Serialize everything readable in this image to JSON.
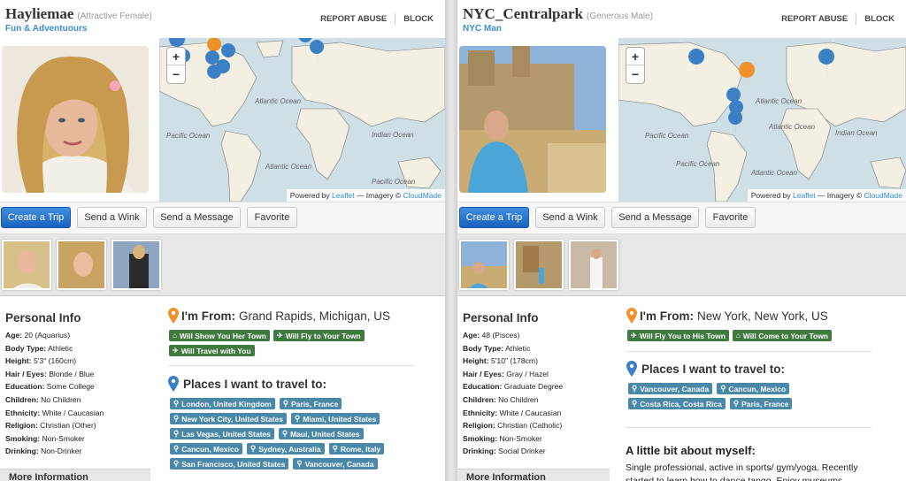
{
  "left": {
    "username": "Hayliemae",
    "user_type": "(Attractive Female)",
    "tagline": "Fun & Adventuours",
    "report_label": "REPORT ABUSE",
    "block_label": "BLOCK",
    "map": {
      "labels": [
        "Atlantic Ocean",
        "Pacific Ocean",
        "Indian Ocean",
        "Atlantic Ocean",
        "Pacific Ocean"
      ],
      "attribution_prefix": "Powered by",
      "attribution_leaflet": "Leaflet",
      "attribution_mid": "— Imagery ©",
      "attribution_cloudmade": "CloudMade",
      "zoom_in": "+",
      "zoom_out": "−"
    },
    "buttons": {
      "create_trip": "Create a Trip",
      "send_wink": "Send a Wink",
      "send_message": "Send a Message",
      "favorite": "Favorite"
    },
    "personal_info_title": "Personal Info",
    "info_rows": [
      {
        "label": "Age:",
        "value": "20 (Aquarius)"
      },
      {
        "label": "Body Type:",
        "value": "Athletic"
      },
      {
        "label": "Height:",
        "value": "5'3\" (160cm)"
      },
      {
        "label": "Hair / Eyes:",
        "value": "Blonde / Blue"
      },
      {
        "label": "Education:",
        "value": "Some College"
      },
      {
        "label": "Children:",
        "value": "No Children"
      },
      {
        "label": "Ethnicity:",
        "value": "White / Caucasian"
      },
      {
        "label": "Religion:",
        "value": "Christian (Other)"
      },
      {
        "label": "Smoking:",
        "value": "Non-Smoker"
      },
      {
        "label": "Drinking:",
        "value": "Non-Drinker"
      }
    ],
    "info_footer": "More Information",
    "from_label": "I'm From:",
    "from_value": "Grand Rapids, Michigan, US",
    "green_badges": [
      "Will Show You Her Town",
      "Will Fly to Your Town",
      "Will Travel with You"
    ],
    "places_title": "Places I want to travel to:",
    "places": [
      "London, United Kingdom",
      "Paris, France",
      "New York City, United States",
      "Miami, United States",
      "Las Vegas, United States",
      "Maui, United States",
      "Cancun, Mexico",
      "Sydney, Australia",
      "Rome, Italy",
      "San Francisco, United States",
      "Vancouver, Canada"
    ]
  },
  "right": {
    "username": "NYC_Centralpark",
    "user_type": "(Generous Male)",
    "tagline": "NYC Man",
    "report_label": "REPORT ABUSE",
    "block_label": "BLOCK",
    "map": {
      "labels": [
        "Atlantic Ocean",
        "Pacific Ocean",
        "Atlantic Ocean",
        "Indian Ocean",
        "Pacific Ocean",
        "Atlantic Ocean"
      ],
      "attribution_prefix": "Powered by",
      "attribution_leaflet": "Leaflet",
      "attribution_mid": "— Imagery ©",
      "attribution_cloudmade": "CloudMade",
      "zoom_in": "+",
      "zoom_out": "−"
    },
    "buttons": {
      "create_trip": "Create a Trip",
      "send_wink": "Send a Wink",
      "send_message": "Send a Message",
      "favorite": "Favorite"
    },
    "personal_info_title": "Personal Info",
    "info_rows": [
      {
        "label": "Age:",
        "value": "48 (Pisces)"
      },
      {
        "label": "Body Type:",
        "value": "Athletic"
      },
      {
        "label": "Height:",
        "value": "5'10\" (178cm)"
      },
      {
        "label": "Hair / Eyes:",
        "value": "Gray / Hazel"
      },
      {
        "label": "Education:",
        "value": "Graduate Degree"
      },
      {
        "label": "Children:",
        "value": "No Children"
      },
      {
        "label": "Ethnicity:",
        "value": "White / Caucasian"
      },
      {
        "label": "Religion:",
        "value": "Christian (Catholic)"
      },
      {
        "label": "Smoking:",
        "value": "Non-Smoker"
      },
      {
        "label": "Drinking:",
        "value": "Social Drinker"
      }
    ],
    "info_footer": "More Information",
    "from_label": "I'm From:",
    "from_value": "New York, New York, US",
    "green_badges": [
      "Will Fly You to His Town",
      "Will Come to Your Town"
    ],
    "places_title": "Places I want to travel to:",
    "places": [
      "Vancouver, Canada",
      "Cancun, Mexico",
      "Costa Rica, Costa Rica",
      "Paris, France"
    ],
    "about_title": "A little bit about myself:",
    "about_text": "Single professional, active in sports/ gym/yoga. Recently started to learn how to dance tango. Enjoy museums"
  },
  "colors": {
    "primary_button": "#1b62c0",
    "green_badge": "#3f7a3f",
    "blue_badge": "#4a88a9",
    "link": "#3b8fd0",
    "pin_blue": "#3b7fc4",
    "pin_orange": "#f0922b"
  }
}
